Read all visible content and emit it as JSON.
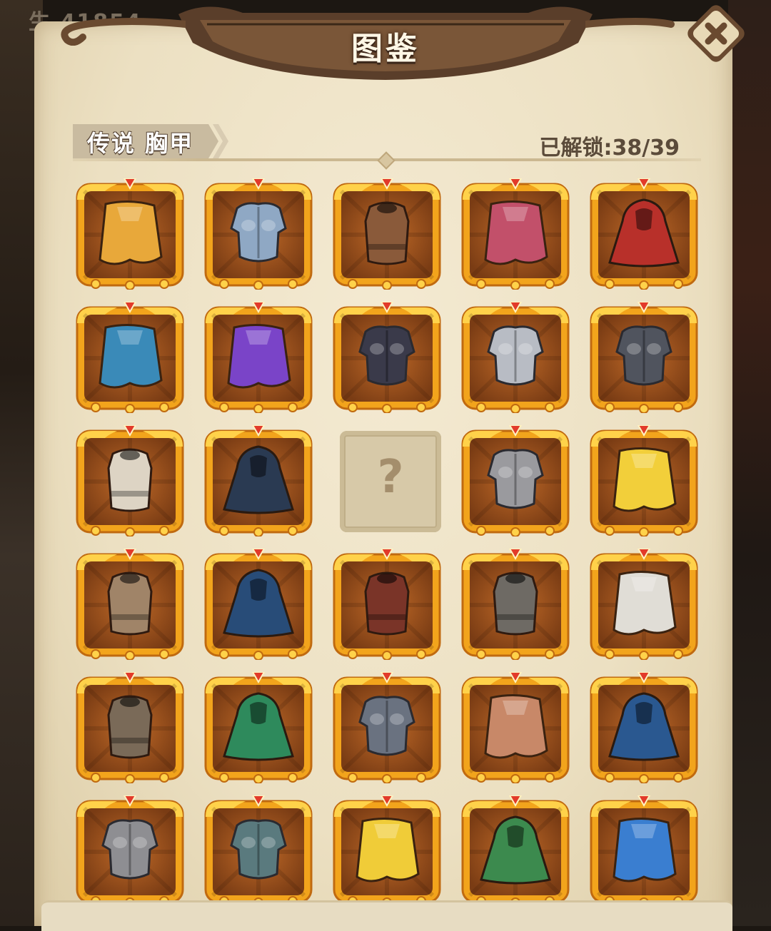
{
  "background": {
    "stat_text": "生   41854"
  },
  "header": {
    "title": "图鉴"
  },
  "close": {
    "icon": "close-icon"
  },
  "category": {
    "label": "传说 胸甲",
    "unlocked_label": "已解锁:38/39"
  },
  "items": [
    {
      "name": "golden-cape",
      "color": "#e8a83a",
      "type": "cape",
      "locked": false
    },
    {
      "name": "steel-muscle-cuirass",
      "color": "#8fa8c4",
      "type": "cuirass",
      "locked": false
    },
    {
      "name": "leather-armor",
      "color": "#8a5a3a",
      "type": "vest",
      "locked": false
    },
    {
      "name": "crimson-sash-cape",
      "color": "#c2506a",
      "type": "cape",
      "locked": false
    },
    {
      "name": "red-hooded-cloak",
      "color": "#b8302a",
      "type": "cloak",
      "locked": false
    },
    {
      "name": "teal-cape",
      "color": "#3a8ab8",
      "type": "cape",
      "locked": false
    },
    {
      "name": "purple-fur-cape",
      "color": "#7a44c8",
      "type": "cape",
      "locked": false
    },
    {
      "name": "black-gold-armor",
      "color": "#3a3a4a",
      "type": "cuirass",
      "locked": false
    },
    {
      "name": "silver-plate-armor",
      "color": "#b8bcc4",
      "type": "cuirass",
      "locked": false
    },
    {
      "name": "dark-iron-armor",
      "color": "#50545e",
      "type": "cuirass",
      "locked": false
    },
    {
      "name": "white-hooded-tunic",
      "color": "#ddd4c4",
      "type": "vest",
      "locked": false
    },
    {
      "name": "dark-fur-cloak",
      "color": "#2a3a52",
      "type": "cloak",
      "locked": false
    },
    {
      "name": "unknown",
      "color": "#d7c9a8",
      "type": "locked",
      "locked": true,
      "placeholder": "?"
    },
    {
      "name": "grey-plate-cuirass",
      "color": "#9a9a9e",
      "type": "cuirass",
      "locked": false
    },
    {
      "name": "yellow-cape",
      "color": "#f2cf3a",
      "type": "cape",
      "locked": false
    },
    {
      "name": "white-hood-robe",
      "color": "#a08468",
      "type": "vest",
      "locked": false
    },
    {
      "name": "navy-cloak",
      "color": "#284c78",
      "type": "cloak",
      "locked": false
    },
    {
      "name": "red-collar-vest",
      "color": "#7a3428",
      "type": "vest",
      "locked": false
    },
    {
      "name": "chainmail",
      "color": "#6e6a64",
      "type": "vest",
      "locked": false
    },
    {
      "name": "white-lace-cape",
      "color": "#e0ddd6",
      "type": "cape",
      "locked": false
    },
    {
      "name": "brown-leather-coat",
      "color": "#7a6a58",
      "type": "vest",
      "locked": false
    },
    {
      "name": "green-vine-cloak",
      "color": "#2e8a5c",
      "type": "cloak",
      "locked": false
    },
    {
      "name": "iron-scarf-armor",
      "color": "#6a7280",
      "type": "cuirass",
      "locked": false
    },
    {
      "name": "brown-tattered-cape",
      "color": "#c88868",
      "type": "cape",
      "locked": false
    },
    {
      "name": "blue-cloak",
      "color": "#2a5890",
      "type": "cloak",
      "locked": false
    },
    {
      "name": "grey-plate-cuirass-2",
      "color": "#8e8e92",
      "type": "cuirass",
      "locked": false
    },
    {
      "name": "teal-plate-armor",
      "color": "#5a7a7e",
      "type": "cuirass",
      "locked": false
    },
    {
      "name": "yellow-cape-2",
      "color": "#f0cc38",
      "type": "cape",
      "locked": false
    },
    {
      "name": "green-fur-cloak",
      "color": "#3c8a4e",
      "type": "cloak",
      "locked": false
    },
    {
      "name": "blue-gold-cape",
      "color": "#3a7ed0",
      "type": "cape",
      "locked": false
    }
  ]
}
